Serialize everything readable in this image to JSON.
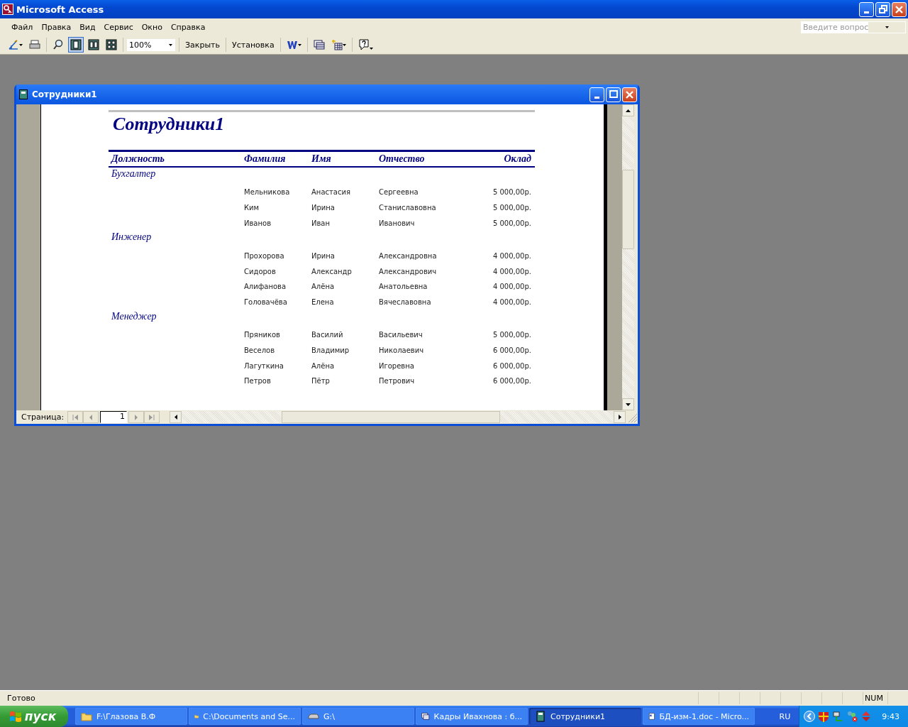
{
  "app_window": {
    "title": "Microsoft Access"
  },
  "menu": [
    "Файл",
    "Правка",
    "Вид",
    "Сервис",
    "Окно",
    "Справка"
  ],
  "help_box": {
    "placeholder": "Введите вопрос"
  },
  "toolbar": {
    "view_buttons": [
      {
        "kind": "one-page",
        "selected": true
      },
      {
        "kind": "two-pages",
        "selected": false
      },
      {
        "kind": "multiple-pages",
        "selected": false
      }
    ],
    "zoom": "100%",
    "buttons": [
      "Закрыть",
      "Установка"
    ]
  },
  "report_window": {
    "title": "Сотрудники1",
    "report": {
      "title": "Сотрудники1",
      "columns": [
        "Должность",
        "Фамилия",
        "Имя",
        "Отчество",
        "Оклад"
      ],
      "groups": [
        {
          "name": "Бухгалтер",
          "rows": [
            [
              "Мельникова",
              "Анастасия",
              "Сергеевна",
              "5 000,00р."
            ],
            [
              "Ким",
              "Ирина",
              "Станиславовна",
              "5 000,00р."
            ],
            [
              "Иванов",
              "Иван",
              "Иванович",
              "5 000,00р."
            ]
          ]
        },
        {
          "name": "Инженер",
          "rows": [
            [
              "Прохорова",
              "Ирина",
              "Александровна",
              "4 000,00р."
            ],
            [
              "Сидоров",
              "Александр",
              "Александрович",
              "4 000,00р."
            ],
            [
              "Алифанова",
              "Алёна",
              "Анатольевна",
              "4 000,00р."
            ],
            [
              "Головачёва",
              "Елена",
              "Вячеславовна",
              "4 000,00р."
            ]
          ]
        },
        {
          "name": "Менеджер",
          "rows": [
            [
              "Пряников",
              "Василий",
              "Васильевич",
              "5 000,00р."
            ],
            [
              "Веселов",
              "Владимир",
              "Николаевич",
              "6 000,00р."
            ],
            [
              "Лагуткина",
              "Алёна",
              "Игоревна",
              "6 000,00р."
            ],
            [
              "Петров",
              "Пётр",
              "Петрович",
              "6 000,00р."
            ]
          ]
        }
      ]
    },
    "navigator": {
      "label": "Страница:",
      "page": "1"
    }
  },
  "status_bar": {
    "text": "Готово",
    "indicator": "NUM"
  },
  "taskbar": {
    "start": "пуск",
    "tasks": [
      {
        "kind": "folder",
        "label": "F:\\Глазова В.Ф",
        "selected": false
      },
      {
        "kind": "folder",
        "label": "C:\\Documents and Se...",
        "selected": false
      },
      {
        "kind": "drive",
        "label": "G:\\",
        "selected": false
      },
      {
        "kind": "database",
        "label": "Кадры Ивахнова : б...",
        "selected": false
      },
      {
        "kind": "report",
        "label": "Сотрудники1",
        "selected": true
      },
      {
        "kind": "document",
        "label": "БД-изм-1.doc - Micro...",
        "selected": false
      }
    ],
    "language": "RU",
    "clock": "9:43"
  }
}
